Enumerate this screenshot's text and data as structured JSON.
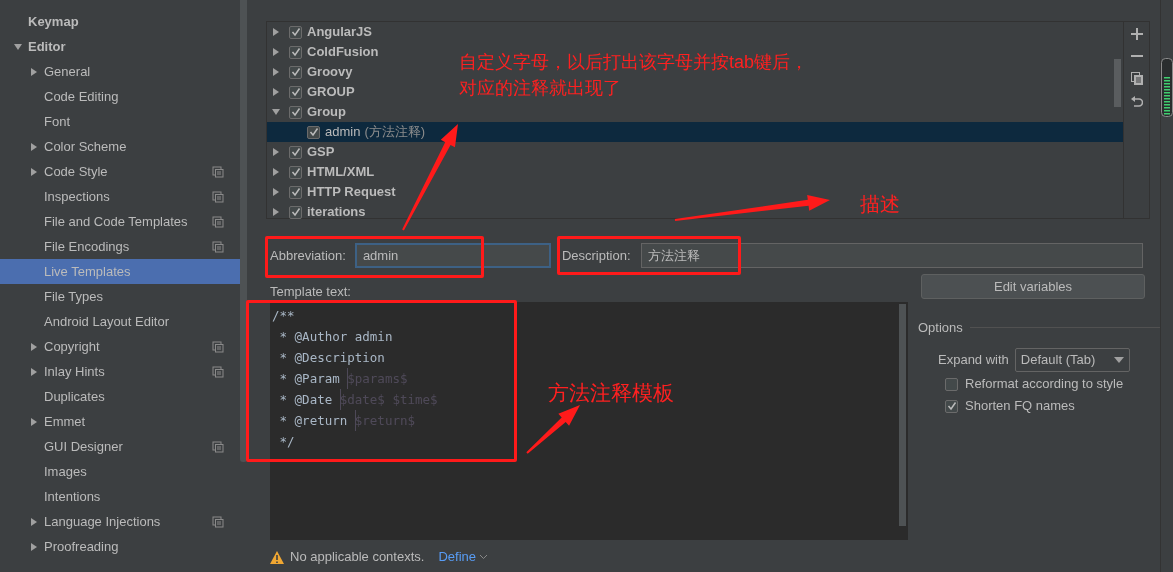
{
  "sidebar": {
    "items": [
      {
        "label": "Keymap",
        "selected": false
      },
      {
        "label": "Editor",
        "selected": false,
        "expanded": true,
        "children": [
          {
            "label": "General",
            "selected": false,
            "expanded": false
          },
          {
            "label": "Code Editing",
            "selected": false
          },
          {
            "label": "Font",
            "selected": false
          },
          {
            "label": "Color Scheme",
            "selected": false,
            "expanded": false
          },
          {
            "label": "Code Style",
            "selected": false,
            "expanded": false,
            "project_scope": true
          },
          {
            "label": "Inspections",
            "selected": false,
            "project_scope": true
          },
          {
            "label": "File and Code Templates",
            "selected": false,
            "project_scope": true
          },
          {
            "label": "File Encodings",
            "selected": false,
            "project_scope": true
          },
          {
            "label": "Live Templates",
            "selected": true
          },
          {
            "label": "File Types",
            "selected": false
          },
          {
            "label": "Android Layout Editor",
            "selected": false
          },
          {
            "label": "Copyright",
            "selected": false,
            "expanded": false,
            "project_scope": true
          },
          {
            "label": "Inlay Hints",
            "selected": false,
            "expanded": false,
            "project_scope": true
          },
          {
            "label": "Duplicates",
            "selected": false
          },
          {
            "label": "Emmet",
            "selected": false,
            "expanded": false
          },
          {
            "label": "GUI Designer",
            "selected": false,
            "project_scope": true
          },
          {
            "label": "Images",
            "selected": false
          },
          {
            "label": "Intentions",
            "selected": false
          },
          {
            "label": "Language Injections",
            "selected": false,
            "expanded": false,
            "project_scope": true
          },
          {
            "label": "Proofreading",
            "selected": false,
            "expanded": false
          }
        ]
      }
    ]
  },
  "templates": {
    "groups": [
      {
        "label": "AngularJS",
        "checked": true,
        "expanded": false
      },
      {
        "label": "ColdFusion",
        "checked": true,
        "expanded": false
      },
      {
        "label": "Groovy",
        "checked": true,
        "expanded": false
      },
      {
        "label": "GROUP",
        "checked": true,
        "expanded": false
      },
      {
        "label": "Group",
        "checked": true,
        "expanded": true,
        "children": [
          {
            "name": "admin",
            "description": "(方法注释)",
            "checked": true,
            "selected": true
          }
        ]
      },
      {
        "label": "GSP",
        "checked": true,
        "expanded": false
      },
      {
        "label": "HTML/XML",
        "checked": true,
        "expanded": false
      },
      {
        "label": "HTTP Request",
        "checked": true,
        "expanded": false
      },
      {
        "label": "iterations",
        "checked": true,
        "expanded": false
      }
    ]
  },
  "abbreviation": {
    "label": "Abbreviation:",
    "value": "admin"
  },
  "description": {
    "label": "Description:",
    "value": "方法注释"
  },
  "template_text": {
    "label": "Template text:",
    "lines": [
      [
        {
          "kind": "plain",
          "text": "/**"
        }
      ],
      [
        {
          "kind": "plain",
          "text": " * @Author admin"
        }
      ],
      [
        {
          "kind": "plain",
          "text": " * @Description"
        }
      ],
      [
        {
          "kind": "plain",
          "text": " * @Param "
        },
        {
          "kind": "variable",
          "text": "$params$"
        }
      ],
      [
        {
          "kind": "plain",
          "text": " * @Date "
        },
        {
          "kind": "variable",
          "text": "$date$ $time$"
        }
      ],
      [
        {
          "kind": "plain",
          "text": " * @return "
        },
        {
          "kind": "variable",
          "text": "$return$"
        }
      ],
      [
        {
          "kind": "plain",
          "text": " */"
        }
      ]
    ]
  },
  "edit_variables_button": "Edit variables",
  "options": {
    "title": "Options",
    "expand_with_label": "Expand with",
    "expand_with_value": "Default (Tab)",
    "checkboxes": [
      {
        "label": "Reformat according to style",
        "checked": false
      },
      {
        "label": "Shorten FQ names",
        "checked": true
      }
    ]
  },
  "footer": {
    "message": "No applicable contexts.",
    "link": "Define"
  },
  "annotations": [
    {
      "text": "自定义字母，以后打出该字母并按tab键后，"
    },
    {
      "text": "对应的注释就出现了"
    },
    {
      "text": "描述"
    },
    {
      "text": "方法注释模板"
    }
  ]
}
